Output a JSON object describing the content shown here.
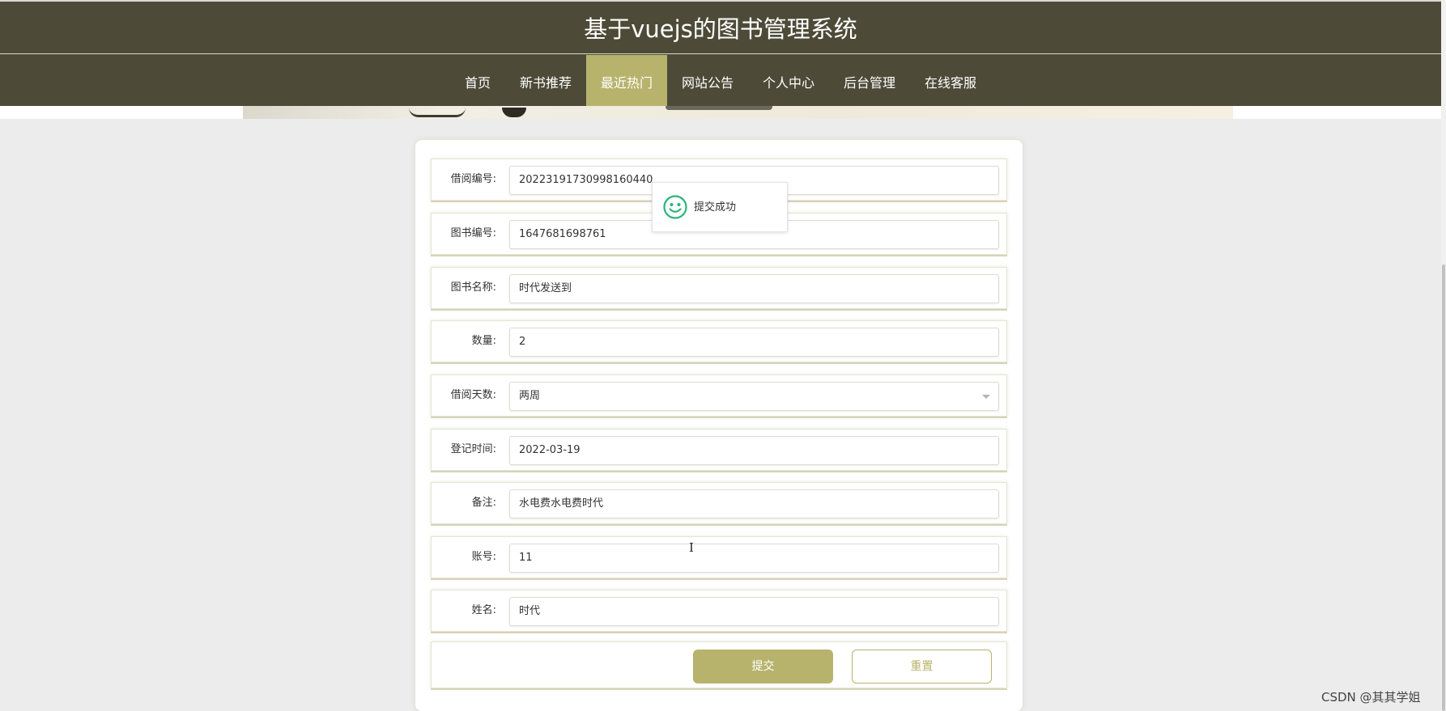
{
  "app": {
    "title": "基于vuejs的图书管理系统"
  },
  "nav": {
    "items": [
      {
        "label": "首页",
        "active": false
      },
      {
        "label": "新书推荐",
        "active": false
      },
      {
        "label": "最近热门",
        "active": true
      },
      {
        "label": "网站公告",
        "active": false
      },
      {
        "label": "个人中心",
        "active": false
      },
      {
        "label": "后台管理",
        "active": false
      },
      {
        "label": "在线客服",
        "active": false
      }
    ]
  },
  "form": {
    "fields": [
      {
        "label": "借阅编号:",
        "value": "20223191730998160440"
      },
      {
        "label": "图书编号:",
        "value": "1647681698761"
      },
      {
        "label": "图书名称:",
        "value": "时代发送到"
      },
      {
        "label": "数量:",
        "value": "2"
      },
      {
        "label": "借阅天数:",
        "value": "两周",
        "type": "select"
      },
      {
        "label": "登记时间:",
        "value": "2022-03-19"
      },
      {
        "label": "备注:",
        "value": "水电费水电费时代"
      },
      {
        "label": "账号:",
        "value": "11"
      },
      {
        "label": "姓名:",
        "value": "时代"
      }
    ],
    "submit_label": "提交",
    "reset_label": "重置"
  },
  "toast": {
    "message": "提交成功",
    "icon": "smile-icon"
  },
  "watermark": "CSDN @其其学姐",
  "colors": {
    "header_bg": "#4d4b38",
    "accent": "#b7b36c",
    "page_bg": "#ececec",
    "success": "#2bb47a"
  }
}
